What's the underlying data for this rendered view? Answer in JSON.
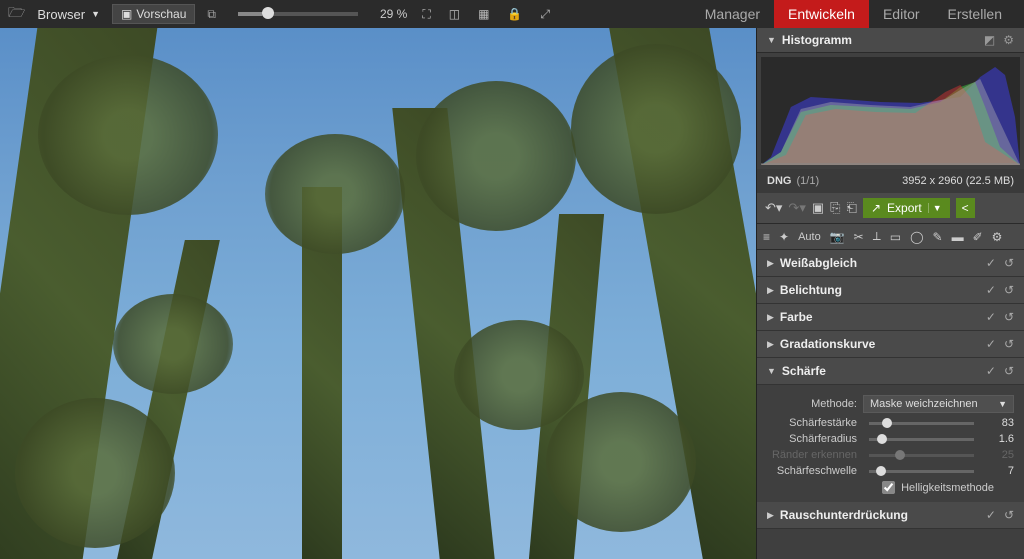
{
  "topbar": {
    "browser_label": "Browser",
    "preview_label": "Vorschau",
    "zoom_percent": "29 %"
  },
  "tabs": {
    "manager": "Manager",
    "develop": "Entwickeln",
    "editor": "Editor",
    "create": "Erstellen"
  },
  "histogram": {
    "title": "Histogramm"
  },
  "fileinfo": {
    "format": "DNG",
    "index": "(1/1)",
    "dims": "3952 x 2960 (22.5 MB)"
  },
  "export": {
    "label": "Export"
  },
  "auto_label": "Auto",
  "sections": {
    "wb": "Weißabgleich",
    "exposure": "Belichtung",
    "color": "Farbe",
    "curve": "Gradationskurve",
    "sharpen": "Schärfe",
    "noise": "Rauschunterdrückung"
  },
  "sharpen": {
    "method_label": "Methode:",
    "method_value": "Maske weichzeichnen",
    "strength_label": "Schärfestärke",
    "strength_value": "83",
    "radius_label": "Schärferadius",
    "radius_value": "1.6",
    "edges_label": "Ränder erkennen",
    "edges_value": "25",
    "threshold_label": "Schärfeschwelle",
    "threshold_value": "7",
    "luminance_label": "Helligkeitsmethode"
  }
}
